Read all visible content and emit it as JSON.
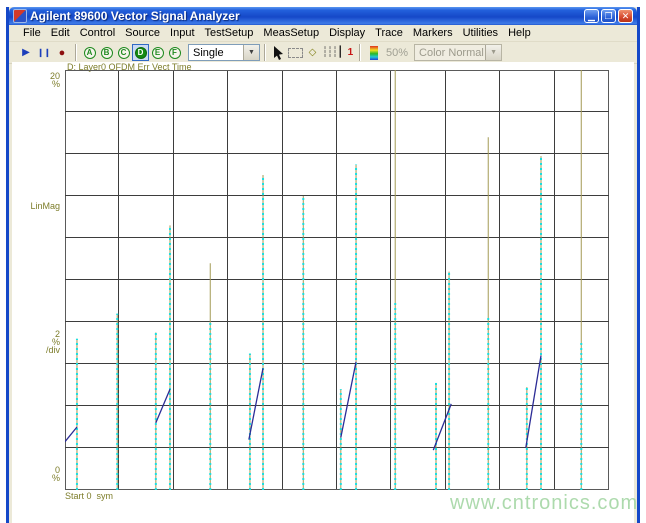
{
  "window": {
    "title": "Agilent 89600 Vector Signal Analyzer",
    "controls": {
      "minimize": "▁",
      "maximize": "❐",
      "close": "✕"
    }
  },
  "menu": {
    "items": [
      "File",
      "Edit",
      "Control",
      "Source",
      "Input",
      "TestSetup",
      "MeasSetup",
      "Display",
      "Trace",
      "Markers",
      "Utilities",
      "Help"
    ]
  },
  "toolbar": {
    "icons": {
      "play": "▶",
      "pause": "❙❙",
      "record": "●",
      "dropdown": "▼",
      "diamond": "◇",
      "vlines": "┆┆┆",
      "marker_bar": "▏",
      "marker_num": "1"
    },
    "trace_buttons": [
      "A",
      "B",
      "C",
      "D",
      "E",
      "F"
    ],
    "active_trace": "D",
    "sweep_mode": "Single",
    "zoom_level": "50%",
    "color_mode": "Color Normal"
  },
  "chart_data": {
    "type": "scatter",
    "title": "D: Layer0 OFDM Err Vect Time",
    "y_axis": {
      "top": [
        "20",
        "%"
      ],
      "mid": "LinMag",
      "per_div": [
        "2",
        "%",
        "/div"
      ],
      "bottom": [
        "0",
        "%"
      ]
    },
    "xlabel": "Start 0  sym",
    "ylim": [
      0,
      20
    ],
    "y_per_div": 2,
    "grid": {
      "cols": 10,
      "rows": 10,
      "on": true
    },
    "colors": {
      "grid": "#3d3d3d",
      "border": "#5a5a5a",
      "cyan": "#1adfdf",
      "olive": "#a39a55",
      "trace_blue": "#2c2c96",
      "labels": "#7d7d2a"
    },
    "spikes": [
      {
        "x": 0.022,
        "cyan_top": 7.2,
        "olive_top": 7.2
      },
      {
        "x": 0.096,
        "cyan_top": 8.4,
        "olive_top": 8.4
      },
      {
        "x": 0.167,
        "cyan_top": 7.5,
        "olive_top": 7.5
      },
      {
        "x": 0.193,
        "cyan_top": 12.6,
        "olive_top": 12.6
      },
      {
        "x": 0.267,
        "cyan_top": 8.0,
        "olive_top": 10.8
      },
      {
        "x": 0.34,
        "cyan_top": 6.5,
        "olive_top": 6.5
      },
      {
        "x": 0.364,
        "cyan_top": 15.0,
        "olive_top": 15.0
      },
      {
        "x": 0.438,
        "cyan_top": 14.0,
        "olive_top": 14.0
      },
      {
        "x": 0.507,
        "cyan_top": 4.8,
        "olive_top": 4.8
      },
      {
        "x": 0.535,
        "cyan_top": 15.5,
        "olive_top": 15.5
      },
      {
        "x": 0.607,
        "cyan_top": 9.0,
        "olive_top": 20.0
      },
      {
        "x": 0.682,
        "cyan_top": 5.1,
        "olive_top": 5.1
      },
      {
        "x": 0.706,
        "cyan_top": 10.4,
        "olive_top": 10.4
      },
      {
        "x": 0.778,
        "cyan_top": 8.3,
        "olive_top": 16.8
      },
      {
        "x": 0.849,
        "cyan_top": 4.9,
        "olive_top": 4.9
      },
      {
        "x": 0.875,
        "cyan_top": 15.9,
        "olive_top": 15.9
      },
      {
        "x": 0.949,
        "cyan_top": 7.0,
        "olive_top": 20.0
      }
    ],
    "trace_segments": [
      {
        "x1": 0.0,
        "y1": 2.3,
        "x2": 0.022,
        "y2": 3.0
      },
      {
        "x1": 0.167,
        "y1": 3.2,
        "x2": 0.193,
        "y2": 4.8
      },
      {
        "x1": 0.338,
        "y1": 2.4,
        "x2": 0.364,
        "y2": 5.8
      },
      {
        "x1": 0.507,
        "y1": 2.5,
        "x2": 0.535,
        "y2": 6.1
      },
      {
        "x1": 0.677,
        "y1": 1.9,
        "x2": 0.71,
        "y2": 4.1
      },
      {
        "x1": 0.847,
        "y1": 2.0,
        "x2": 0.875,
        "y2": 6.4
      }
    ]
  },
  "watermark": "www.cntronics.com"
}
